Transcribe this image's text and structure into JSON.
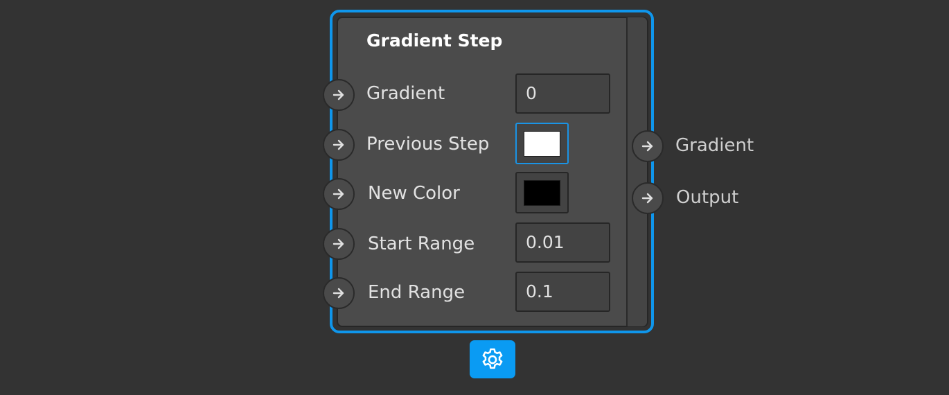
{
  "node": {
    "title": "Gradient Step",
    "inputs": [
      {
        "label": "Gradient",
        "value": "0"
      },
      {
        "label": "Previous Step",
        "color": "#ffffff"
      },
      {
        "label": "New Color",
        "color": "#000000"
      },
      {
        "label": "Start Range",
        "value": "0.01"
      },
      {
        "label": "End Range",
        "value": "0.1"
      }
    ],
    "outputs": [
      {
        "label": "Gradient"
      },
      {
        "label": "Output"
      }
    ]
  },
  "colors": {
    "background": "#333333",
    "selection_accent": "#0f96ec",
    "node_body": "#4b4b4b",
    "settings_button": "#0a9bf3"
  },
  "icons": {
    "port": "arrow-right-icon",
    "settings": "gear-icon"
  }
}
